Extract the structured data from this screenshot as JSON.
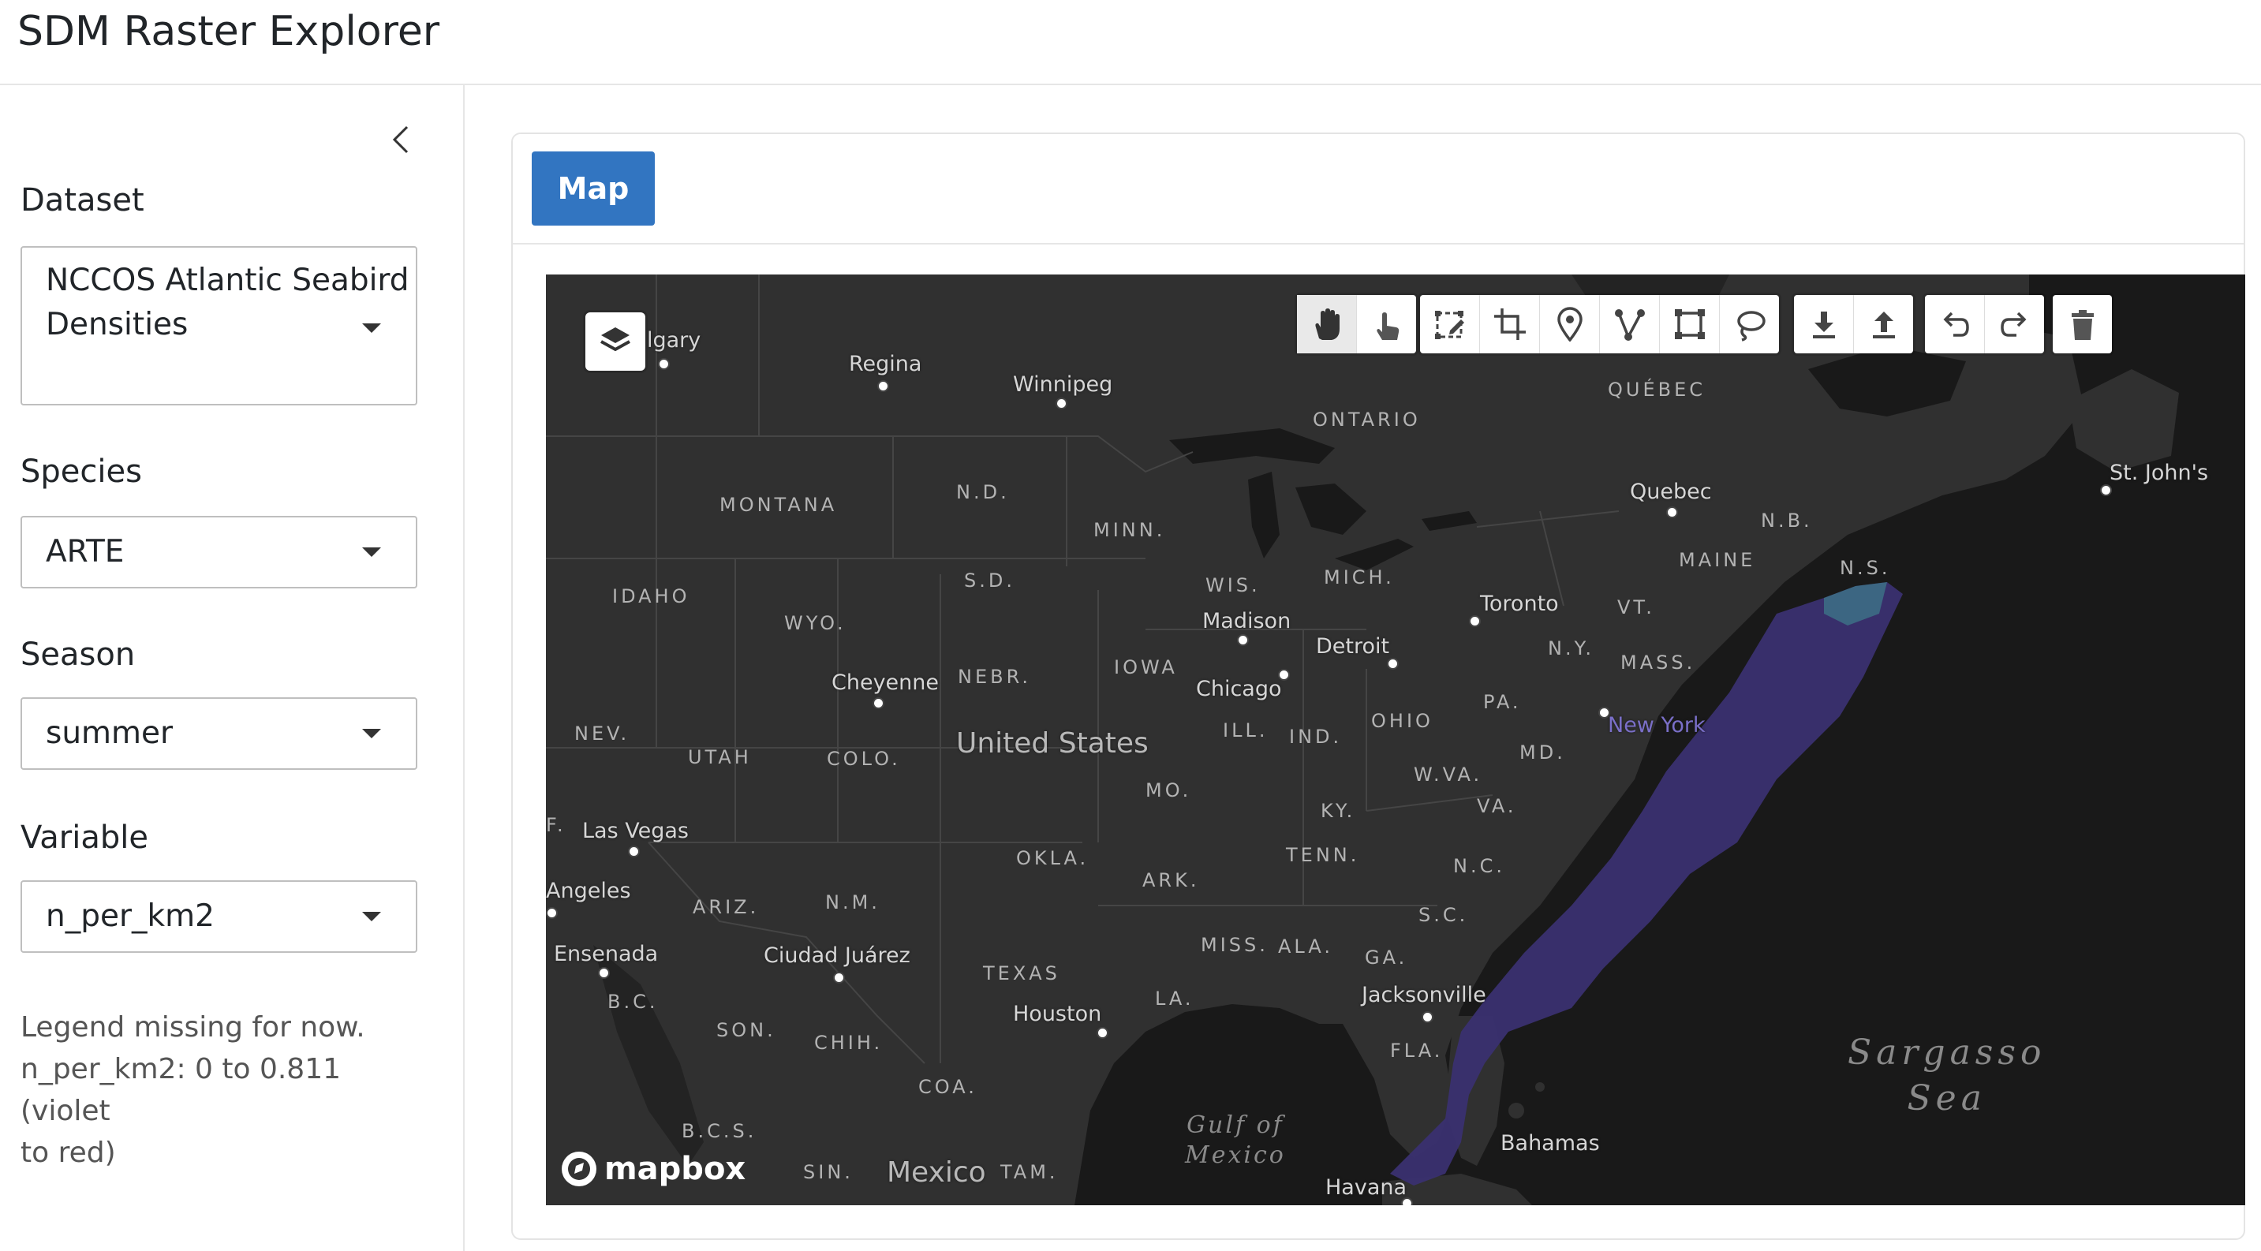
{
  "app": {
    "title": "SDM Raster Explorer"
  },
  "sidebar": {
    "dataset": {
      "label": "Dataset",
      "value_line1": "NCCOS Atlantic Seabird",
      "value_line2": "Densities"
    },
    "species": {
      "label": "Species",
      "value": "ARTE"
    },
    "season": {
      "label": "Season",
      "value": "summer"
    },
    "variable": {
      "label": "Variable",
      "value": "n_per_km2"
    },
    "note": {
      "line1": "Legend missing for now.",
      "line2": "n_per_km2: 0 to 0.811 (violet",
      "line3": "to red)"
    }
  },
  "main": {
    "tabs": [
      {
        "label": "Map",
        "active": true
      }
    ]
  },
  "map": {
    "cities": [
      "lgary",
      "Regina",
      "Winnipeg",
      "Quebec",
      "St. John's",
      "Toronto",
      "Madison",
      "Detroit",
      "Chicago",
      "Cheyenne",
      "New York",
      "Las Vegas",
      "Angeles",
      "Ensenada",
      "Ciudad Juárez",
      "Houston",
      "Jacksonville",
      "Havana",
      "Bahamas"
    ],
    "regions": [
      "QUÉBEC",
      "ONTARIO",
      "MONTANA",
      "N.D.",
      "MINN.",
      "N.B.",
      "MAINE",
      "N.S.",
      "S.D.",
      "WIS.",
      "MICH.",
      "VT.",
      "IDAHO",
      "WYO.",
      "NEBR.",
      "IOWA",
      "N.Y.",
      "MASS.",
      "PA.",
      "ILL.",
      "IND.",
      "OHIO",
      "MD.",
      "NEV.",
      "UTAH",
      "COLO.",
      "W.VA.",
      "VA.",
      "MO.",
      "KY.",
      "OKLA.",
      "TENN.",
      "N.C.",
      "ARK.",
      "ARIZ.",
      "N.M.",
      "S.C.",
      "MISS.",
      "ALA.",
      "GA.",
      "TEXAS",
      "LA.",
      "B.C.",
      "SON.",
      "CHIH.",
      "FLA.",
      "COA.",
      "B.C.S.",
      "SIN.",
      "TAM.",
      "F."
    ],
    "country": "United States",
    "country2": "Mexico",
    "sea": {
      "line1": "Sargasso",
      "line2": "Sea"
    },
    "gulf": {
      "line1": "Gulf of",
      "line2": "Mexico"
    },
    "attribution": "mapbox",
    "raster_color": "#3a3070",
    "toolbar_icons": [
      "pan-hand-icon",
      "touch-icon",
      "edit-box-icon",
      "crop-icon",
      "marker-icon",
      "polyline-icon",
      "rectangle-icon",
      "lasso-icon",
      "download-icon",
      "upload-icon",
      "undo-icon",
      "redo-icon",
      "trash-icon"
    ]
  }
}
